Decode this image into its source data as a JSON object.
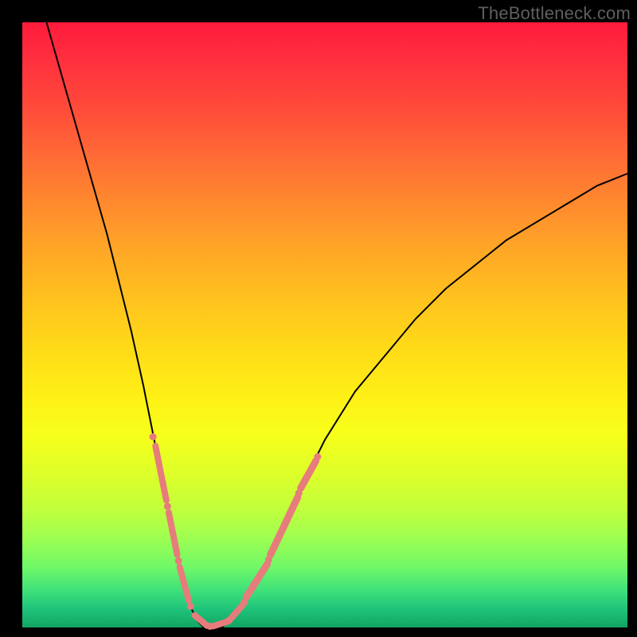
{
  "watermark": "TheBottleneck.com",
  "colors": {
    "background": "#000000",
    "gradient_top": "#ff1a3c",
    "gradient_bottom": "#12a463",
    "curve": "#000000",
    "markers": "#e77c7c"
  },
  "chart_data": {
    "type": "line",
    "title": "",
    "xlabel": "",
    "ylabel": "",
    "xlim": [
      0,
      100
    ],
    "ylim": [
      0,
      100
    ],
    "grid": false,
    "legend": false,
    "series": [
      {
        "name": "bottleneck-curve",
        "x": [
          4,
          6,
          8,
          10,
          12,
          14,
          16,
          18,
          20,
          22,
          23,
          24,
          25,
          26,
          27,
          28,
          29,
          30,
          31,
          32,
          33,
          34,
          35,
          36,
          38,
          40,
          42,
          44,
          46,
          48,
          50,
          55,
          60,
          65,
          70,
          75,
          80,
          85,
          90,
          95,
          100
        ],
        "y": [
          100,
          93,
          86,
          79,
          72,
          65,
          57,
          49,
          40,
          30,
          25,
          20,
          15,
          10,
          6,
          3,
          1,
          0,
          0,
          0,
          0,
          1,
          2,
          3,
          6,
          10,
          14,
          19,
          23,
          27,
          31,
          39,
          45,
          51,
          56,
          60,
          64,
          67,
          70,
          73,
          75
        ]
      }
    ],
    "markers": {
      "name": "highlighted-segments",
      "strokes": [
        {
          "x1": 22.0,
          "y1": 30.0,
          "x2": 23.8,
          "y2": 21.0,
          "w": 8
        },
        {
          "x1": 24.2,
          "y1": 19.0,
          "x2": 25.6,
          "y2": 12.0,
          "w": 8
        },
        {
          "x1": 26.0,
          "y1": 10.0,
          "x2": 27.5,
          "y2": 4.5,
          "w": 8
        },
        {
          "x1": 28.5,
          "y1": 2.0,
          "x2": 30.5,
          "y2": 0.3,
          "w": 8
        },
        {
          "x1": 31.5,
          "y1": 0.2,
          "x2": 34.0,
          "y2": 1.0,
          "w": 8
        },
        {
          "x1": 34.5,
          "y1": 1.5,
          "x2": 36.5,
          "y2": 3.8,
          "w": 8
        },
        {
          "x1": 37.0,
          "y1": 5.0,
          "x2": 40.5,
          "y2": 10.5,
          "w": 9
        },
        {
          "x1": 41.0,
          "y1": 12.0,
          "x2": 45.5,
          "y2": 21.5,
          "w": 9
        },
        {
          "x1": 46.0,
          "y1": 23.0,
          "x2": 48.5,
          "y2": 27.5,
          "w": 9
        }
      ],
      "dots": [
        {
          "x": 21.6,
          "y": 31.5,
          "r": 3.3
        },
        {
          "x": 24.0,
          "y": 20.0,
          "r": 3.3
        },
        {
          "x": 25.8,
          "y": 11.0,
          "r": 3.3
        },
        {
          "x": 27.8,
          "y": 3.5,
          "r": 3.3
        },
        {
          "x": 31.0,
          "y": 0.2,
          "r": 3.3
        },
        {
          "x": 34.2,
          "y": 1.2,
          "r": 3.3
        },
        {
          "x": 36.7,
          "y": 4.2,
          "r": 3.3
        },
        {
          "x": 40.7,
          "y": 11.2,
          "r": 3.3
        },
        {
          "x": 45.7,
          "y": 22.2,
          "r": 3.3
        },
        {
          "x": 48.8,
          "y": 28.2,
          "r": 3.3
        }
      ]
    }
  }
}
